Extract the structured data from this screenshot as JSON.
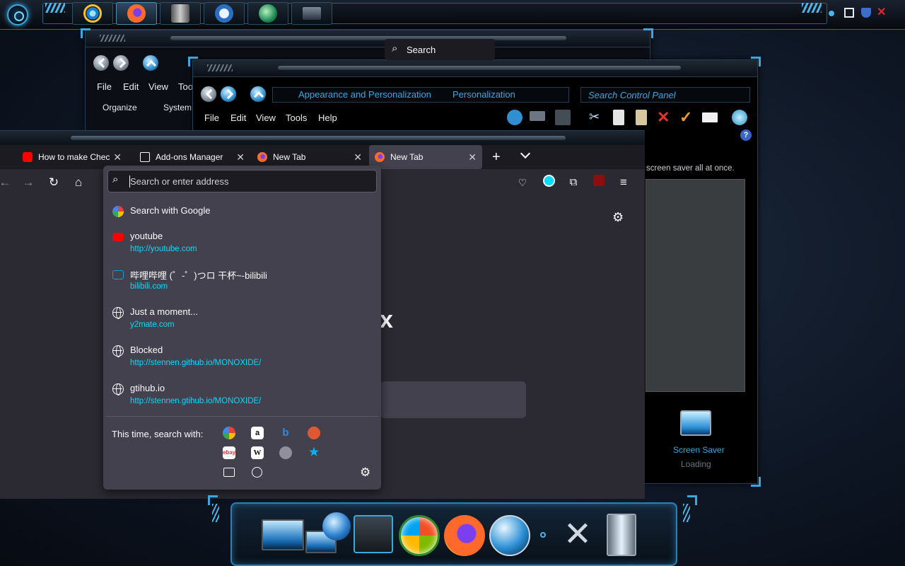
{
  "taskbar": {
    "start_label": "Start",
    "apps": [
      "Internet Explorer",
      "Firefox",
      "Media",
      "Windows Media Player",
      "Browser",
      "Control Panel"
    ]
  },
  "back_window": {
    "menu": [
      "File",
      "Edit",
      "View",
      "Too"
    ],
    "toolbar": [
      "Organize",
      "System p"
    ]
  },
  "control_panel": {
    "breadcrumb": [
      "Appearance and Personalization",
      "Personalization"
    ],
    "search_placeholder": "Search Control Panel",
    "menu": [
      "File",
      "Edit",
      "View",
      "Tools",
      "Help"
    ],
    "description_snippet": "screen saver all at once.",
    "screen_saver_label": "Screen Saver",
    "screen_saver_status": "Loading"
  },
  "firefox": {
    "tabs": [
      {
        "title": "How to make Chec",
        "favicon": "youtube-icon"
      },
      {
        "title": "Add-ons Manager",
        "favicon": "puzzle-icon"
      },
      {
        "title": "New Tab",
        "favicon": "firefox-icon"
      },
      {
        "title": "New Tab",
        "favicon": "firefox-icon",
        "selected": true
      }
    ],
    "search_label": "Search",
    "content_fragment": "x",
    "urlbar": {
      "placeholder": "Search or enter address",
      "results": [
        {
          "title": "Search with Google",
          "url": "",
          "icon": "google-icon"
        },
        {
          "title": "youtube",
          "url": "http://youtube.com",
          "icon": "youtube-icon"
        },
        {
          "title": "哔哩哔哩 (゜-゜)つロ 干杯~-bilibili",
          "url": "bilibili.com",
          "icon": "bilibili-icon"
        },
        {
          "title": "Just a moment...",
          "url": "y2mate.com",
          "icon": "globe-icon"
        },
        {
          "title": "Blocked",
          "url": "http://stennen.github.io/MONOXIDE/",
          "icon": "globe-icon"
        },
        {
          "title": "gtihub.io",
          "url": "http://stennen.gtihub.io/MONOXIDE/",
          "icon": "globe-icon"
        }
      ],
      "one_off_label": "This time, search with:",
      "engines": [
        "Google",
        "Amazon",
        "Bing",
        "DuckDuckGo",
        "eBay",
        "Wikipedia",
        "Search",
        "Bookmarks",
        "Tabs",
        "History"
      ]
    }
  },
  "colors": {
    "accent": "#00ddff",
    "frame_blue": "#3aa7e0",
    "popup_bg": "#42414d"
  }
}
